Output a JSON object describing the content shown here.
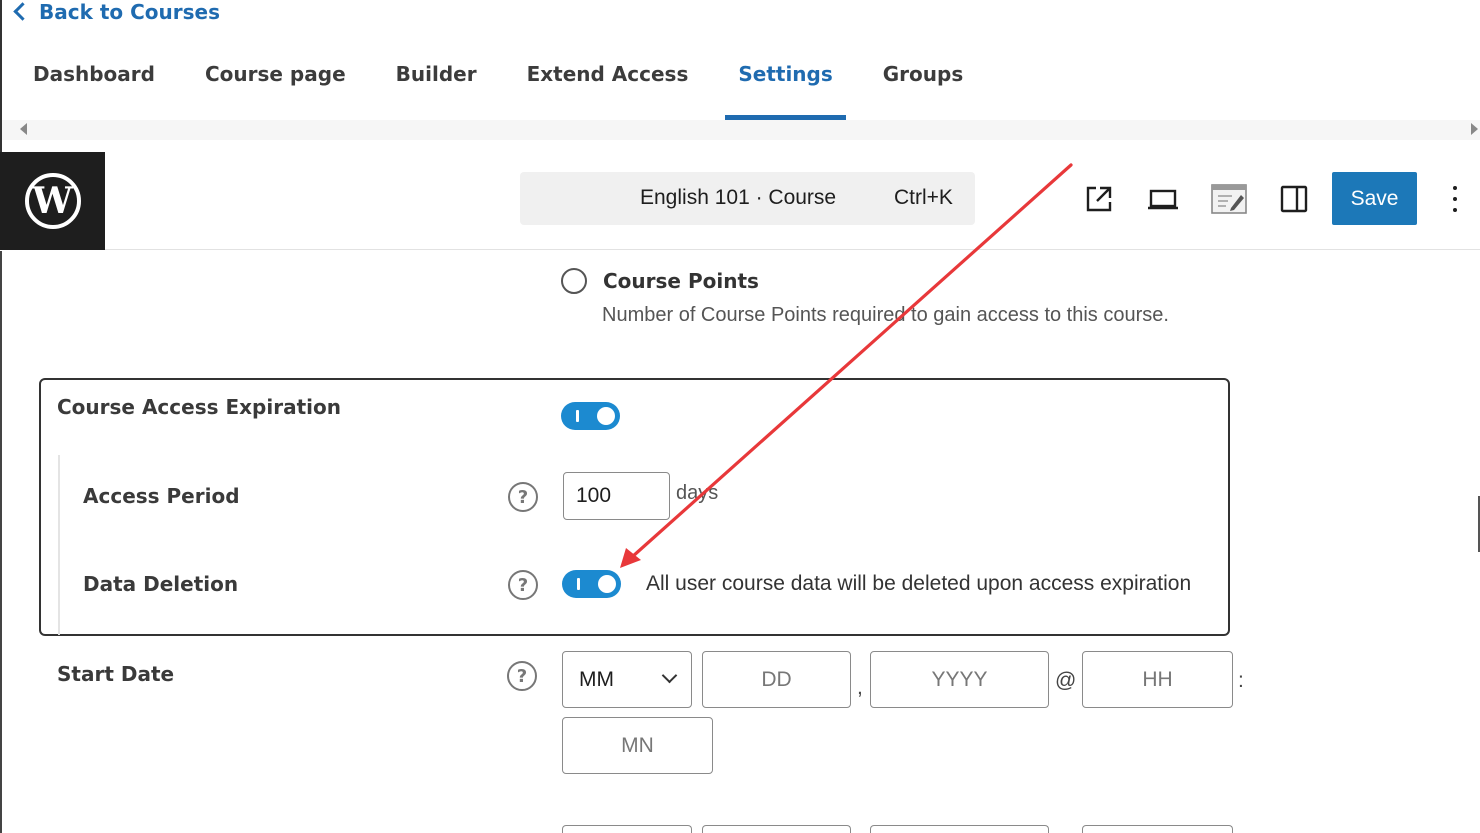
{
  "header": {
    "back_label": "Back to Courses",
    "tabs": [
      {
        "label": "Dashboard",
        "active": false
      },
      {
        "label": "Course page",
        "active": false
      },
      {
        "label": "Builder",
        "active": false
      },
      {
        "label": "Extend Access",
        "active": false
      },
      {
        "label": "Settings",
        "active": true
      },
      {
        "label": "Groups",
        "active": false
      }
    ]
  },
  "editor": {
    "logo": "W",
    "command_title": "English 101 · Course",
    "command_shortcut": "Ctrl+K",
    "icons": [
      "external-link-icon",
      "desktop-preview-icon",
      "edit-mode-icon",
      "sidebar-toggle-icon"
    ],
    "save_label": "Save"
  },
  "settings": {
    "course_points": {
      "label": "Course Points",
      "description": "Number of Course Points required to gain access to this course.",
      "selected": false
    },
    "access_expiration": {
      "label": "Course Access Expiration",
      "enabled": true,
      "access_period": {
        "label": "Access Period",
        "value": "100",
        "unit": "days"
      },
      "data_deletion": {
        "label": "Data Deletion",
        "enabled": true,
        "description": "All user course data will be deleted upon access expiration"
      }
    },
    "start_date": {
      "label": "Start Date",
      "month_placeholder": "MM",
      "day_placeholder": "DD",
      "year_placeholder": "YYYY",
      "hour_placeholder": "HH",
      "minute_placeholder": "MN",
      "comma": ",",
      "at": "@",
      "colon": ":"
    }
  },
  "help_symbol": "?",
  "colors": {
    "accent": "#1f6bb0",
    "toggle_on": "#1c8ad0",
    "save_button": "#1c78b8",
    "annotation_arrow": "#e8383a"
  }
}
